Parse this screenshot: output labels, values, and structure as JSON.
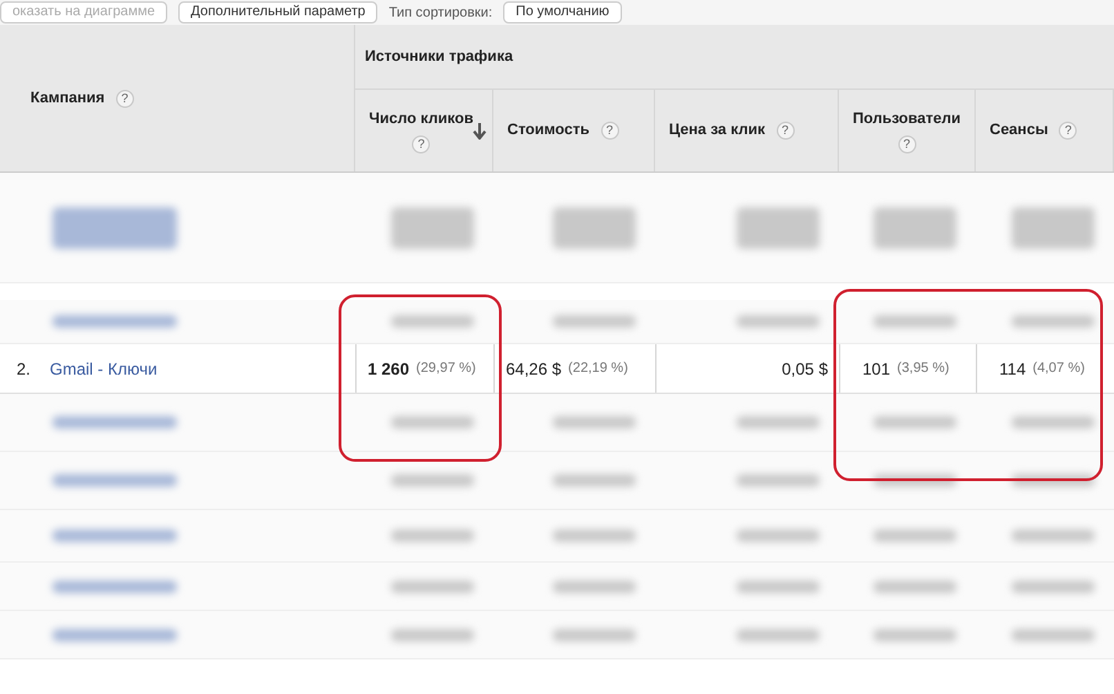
{
  "toolbar": [
    {
      "kind": "button",
      "label": "оказать на диаграмме",
      "disabled": true
    },
    {
      "kind": "button",
      "label": "Дополнительный параметр",
      "disabled": false
    },
    {
      "kind": "label",
      "label": "Тип сортировки:"
    },
    {
      "kind": "button",
      "label": "По умолчанию",
      "disabled": false
    }
  ],
  "table": {
    "first_column": {
      "label": "Кампания",
      "help": "?"
    },
    "group": {
      "label": "Источники трафика"
    },
    "columns": [
      {
        "label": "Число кликов",
        "help": "?",
        "sorted": true
      },
      {
        "label": "Стоимость",
        "help": "?",
        "sorted": false
      },
      {
        "label": "Цена за клик",
        "help": "?",
        "sorted": false
      },
      {
        "label": "Пользователи",
        "help": "?",
        "sorted": false
      },
      {
        "label": "Сеансы",
        "help": "?",
        "sorted": false
      }
    ],
    "row": {
      "index": "2.",
      "campaign": "Gmail - Ключи",
      "cells": [
        {
          "value": "1 260",
          "share": "(29,97 %)",
          "bold": true
        },
        {
          "value": "64,26 $",
          "share": "(22,19 %)",
          "bold": false
        },
        {
          "value": "0,05 $",
          "bold": false
        },
        {
          "value": "101",
          "share": "(3,95 %)",
          "bold": false
        },
        {
          "value": "114",
          "share": "(4,07 %)",
          "bold": false
        }
      ]
    }
  }
}
